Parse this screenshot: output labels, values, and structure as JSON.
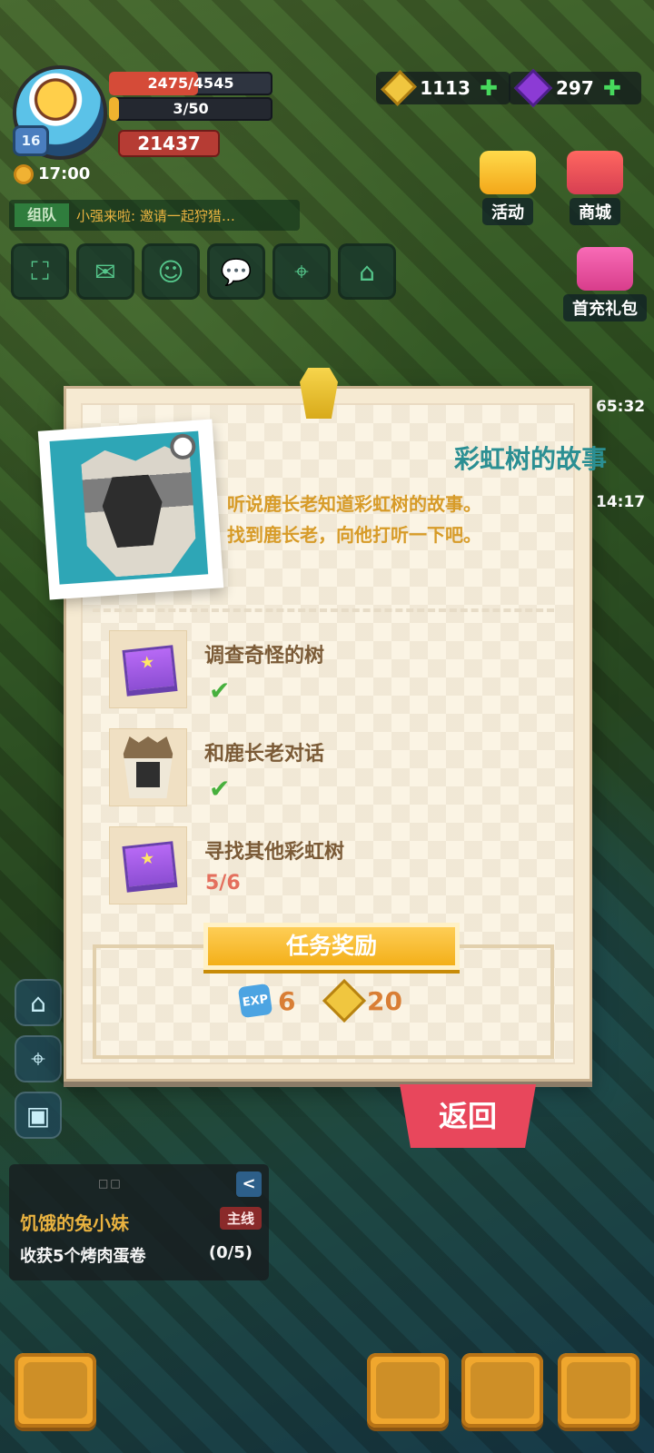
{
  "hud": {
    "level": "16",
    "time": "17:00",
    "hp_text": "2475/4545",
    "hp_fraction": 0.545,
    "energy_text": "3/50",
    "energy_fraction": 0.06,
    "power": "21437",
    "gold": "1113",
    "gems": "297",
    "team_tag": "组队",
    "team_message": "小强来啦: 邀请一起狩猎…"
  },
  "top_buttons": {
    "activity": "活动",
    "store": "商城",
    "first_pack": "首充礼包",
    "timer_1": "65:32",
    "timer_2": "14:17"
  },
  "quest_modal": {
    "title": "彩虹树的故事",
    "description_lines": [
      "听说鹿长老知道彩虹树的故事。",
      "找到鹿长老，向他打听一下吧。"
    ],
    "objectives": [
      {
        "label": "调查奇怪的树",
        "status": "done",
        "progress": ""
      },
      {
        "label": "和鹿长老对话",
        "status": "done",
        "progress": ""
      },
      {
        "label": "寻找其他彩虹树",
        "status": "in_progress",
        "progress": "5/6"
      }
    ],
    "reward_label": "任务奖励",
    "exp_reward_icon": "EXP",
    "exp_reward": "6",
    "coin_reward": "20",
    "back_button": "返回"
  },
  "task_tracker": {
    "title": "饥饿的兔小妹",
    "tag": "主线",
    "description": "收获5个烤肉蛋卷",
    "progress": "(0/5)"
  },
  "icons": {
    "check": "✔",
    "plus": "✚",
    "collapse": "<"
  },
  "colors": {
    "accent_teal": "#2b8f93",
    "accent_gold": "#d79b28",
    "success_green": "#47b03d",
    "warning_red": "#e46f5d",
    "button_red": "#e8475c"
  }
}
